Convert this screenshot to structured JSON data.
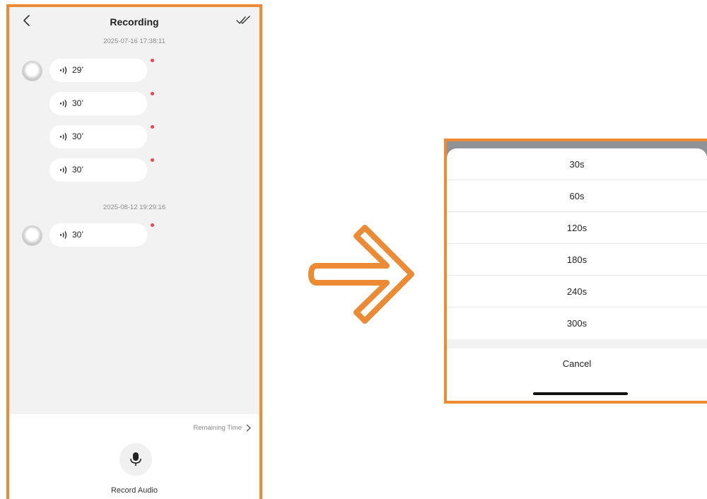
{
  "header": {
    "title": "Recording"
  },
  "groups": [
    {
      "timestamp": "2025-07-16 17:38:11",
      "messages": [
        {
          "duration": "29’"
        },
        {
          "duration": "30’"
        },
        {
          "duration": "30’"
        },
        {
          "duration": "30’"
        }
      ]
    },
    {
      "timestamp": "2025-08-12 19:29:16",
      "messages": [
        {
          "duration": "30’"
        }
      ]
    }
  ],
  "footer": {
    "remaining_label": "Remaining Time",
    "record_label": "Record Audio"
  },
  "sheet": {
    "options": [
      "30s",
      "60s",
      "120s",
      "180s",
      "240s",
      "300s"
    ],
    "cancel_label": "Cancel"
  },
  "colors": {
    "accent": "#ed8a34",
    "unread": "#e5484d"
  }
}
